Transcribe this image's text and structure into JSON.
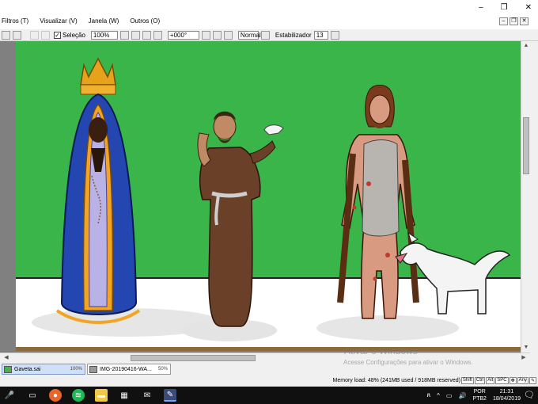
{
  "window": {
    "controls": [
      "–",
      "❐",
      "✕"
    ],
    "inner_controls": [
      "–",
      "❐",
      "✕"
    ]
  },
  "menu": [
    {
      "label": "Filtros (T)"
    },
    {
      "label": "Visualizar (V)"
    },
    {
      "label": "Janela (W)"
    },
    {
      "label": "Outros (O)"
    }
  ],
  "toolbar": {
    "selection_label": "Seleção",
    "selection_checked": true,
    "zoom": "100%",
    "rotation": "+000°",
    "blend_mode": "Normal",
    "stabilizer_label": "Estabilizador",
    "stabilizer_value": "13"
  },
  "canvas": {
    "background_color": "#39b54a",
    "floor_color": "#ffffff"
  },
  "doc_tabs": [
    {
      "name": "Gaveta.sai",
      "zoom": "100%",
      "active": true
    },
    {
      "name": "IMG-20190416-WA...",
      "zoom": "50%",
      "active": false
    }
  ],
  "status": {
    "memory": "Memory load: 48% (241MB used / 918MB reserved)",
    "keys": [
      "Shift",
      "Ctrl",
      "Alt",
      "SPC"
    ],
    "key_extra": "Any"
  },
  "watermark": {
    "title": "Ativar o Windows",
    "subtitle": "Acesse Configurações para ativar o Windows."
  },
  "taskbar": {
    "apps": [
      "microphone-icon",
      "task-view-icon",
      "firefox-icon",
      "spotify-icon",
      "file-explorer-icon",
      "store-icon",
      "mail-icon",
      "paint-tool-sai-icon"
    ],
    "lang_top": "POR",
    "lang_bottom": "PTB2",
    "time": "21:31",
    "date": "18/04/2019"
  }
}
